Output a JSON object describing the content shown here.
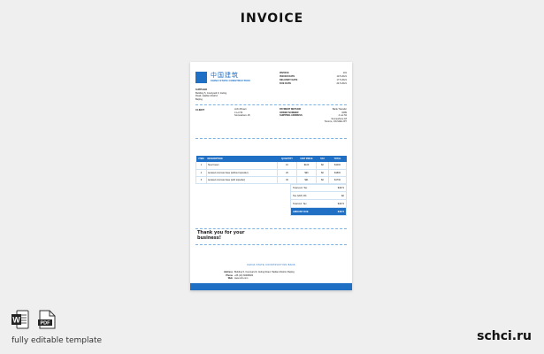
{
  "page_title": "INVOICE",
  "invoice": {
    "logo_cn": "中国建筑",
    "logo_en": "CHINA STATE CONSTRUCTION",
    "meta": [
      {
        "label": "INVOICE",
        "value": "101"
      },
      {
        "label": "ISSUED DATE",
        "value": "10.5.2021"
      },
      {
        "label": "DELIVERY DATE",
        "value": "17.5.2021"
      },
      {
        "label": "DUE DATE",
        "value": "24.5.2021"
      }
    ],
    "supplier": {
      "heading": "SUPPLIER",
      "lines": [
        "Building 5, Courtyard 9, Jiuling",
        "Road, Haidian District",
        "Beijing"
      ]
    },
    "client": {
      "heading": "CLIENT",
      "lines": [
        "John Brown",
        "4 Lot 54",
        "Somewhere 18"
      ]
    },
    "payment": [
      {
        "label": "PAYMENT METHOD",
        "value": "Bank Transfer"
      },
      {
        "label": "ORDER NUMBER",
        "value": "1089"
      },
      {
        "label": "SHIPPING ADDRESS",
        "value": "4 Lot 54"
      }
    ],
    "payment_extra": [
      "Somewhere 18",
      "Toronto, ON M2E 2P7"
    ],
    "table": {
      "headers": {
        "item": "ITEM",
        "description": "DESCRIPTION",
        "quantity": "QUANTITY",
        "unit_price": "UNIT PRICE",
        "tax": "TAX",
        "total": "TOTAL"
      },
      "rows": [
        {
          "item": "1",
          "description": "Steel beam",
          "quantity": "10",
          "unit_price": "$100",
          "tax": "$0",
          "total": "$1000"
        },
        {
          "item": "2",
          "description": "Aerated concrete base (without topsoiler)",
          "quantity": "20",
          "unit_price": "$90",
          "tax": "$0",
          "total": "$1800"
        },
        {
          "item": "3",
          "description": "Aerated concrete base (with topsoiler)",
          "quantity": "30",
          "unit_price": "$91",
          "tax": "$0",
          "total": "$1730"
        }
      ]
    },
    "totals": [
      {
        "label": "Total excl. Tax",
        "value": "$4074"
      },
      {
        "label": "Tax (VAT) 0%",
        "value": "$0"
      },
      {
        "label": "Total incl. Tax",
        "value": "$4074"
      },
      {
        "label": "AMOUNT DUE",
        "value": "$4074"
      }
    ],
    "thanks": "Thank you for your business!",
    "footer": {
      "company": "CHINA STATE CONSTRUCTION BANK",
      "lines": [
        {
          "label": "Address",
          "value": "Building 5, Courtyard 9, Jiuling Road, Haidian District, Beijing"
        },
        {
          "label": "Phone",
          "value": "+86 (10) 66488484"
        },
        {
          "label": "Web",
          "value": "www.ccb.com"
        }
      ]
    }
  },
  "file_icons": {
    "word": "W",
    "pdf": "PDF"
  },
  "editable_text": "fully editable template",
  "brand": "schci.ru",
  "colors": {
    "accent": "#1f6fc4",
    "background": "#efefef"
  }
}
